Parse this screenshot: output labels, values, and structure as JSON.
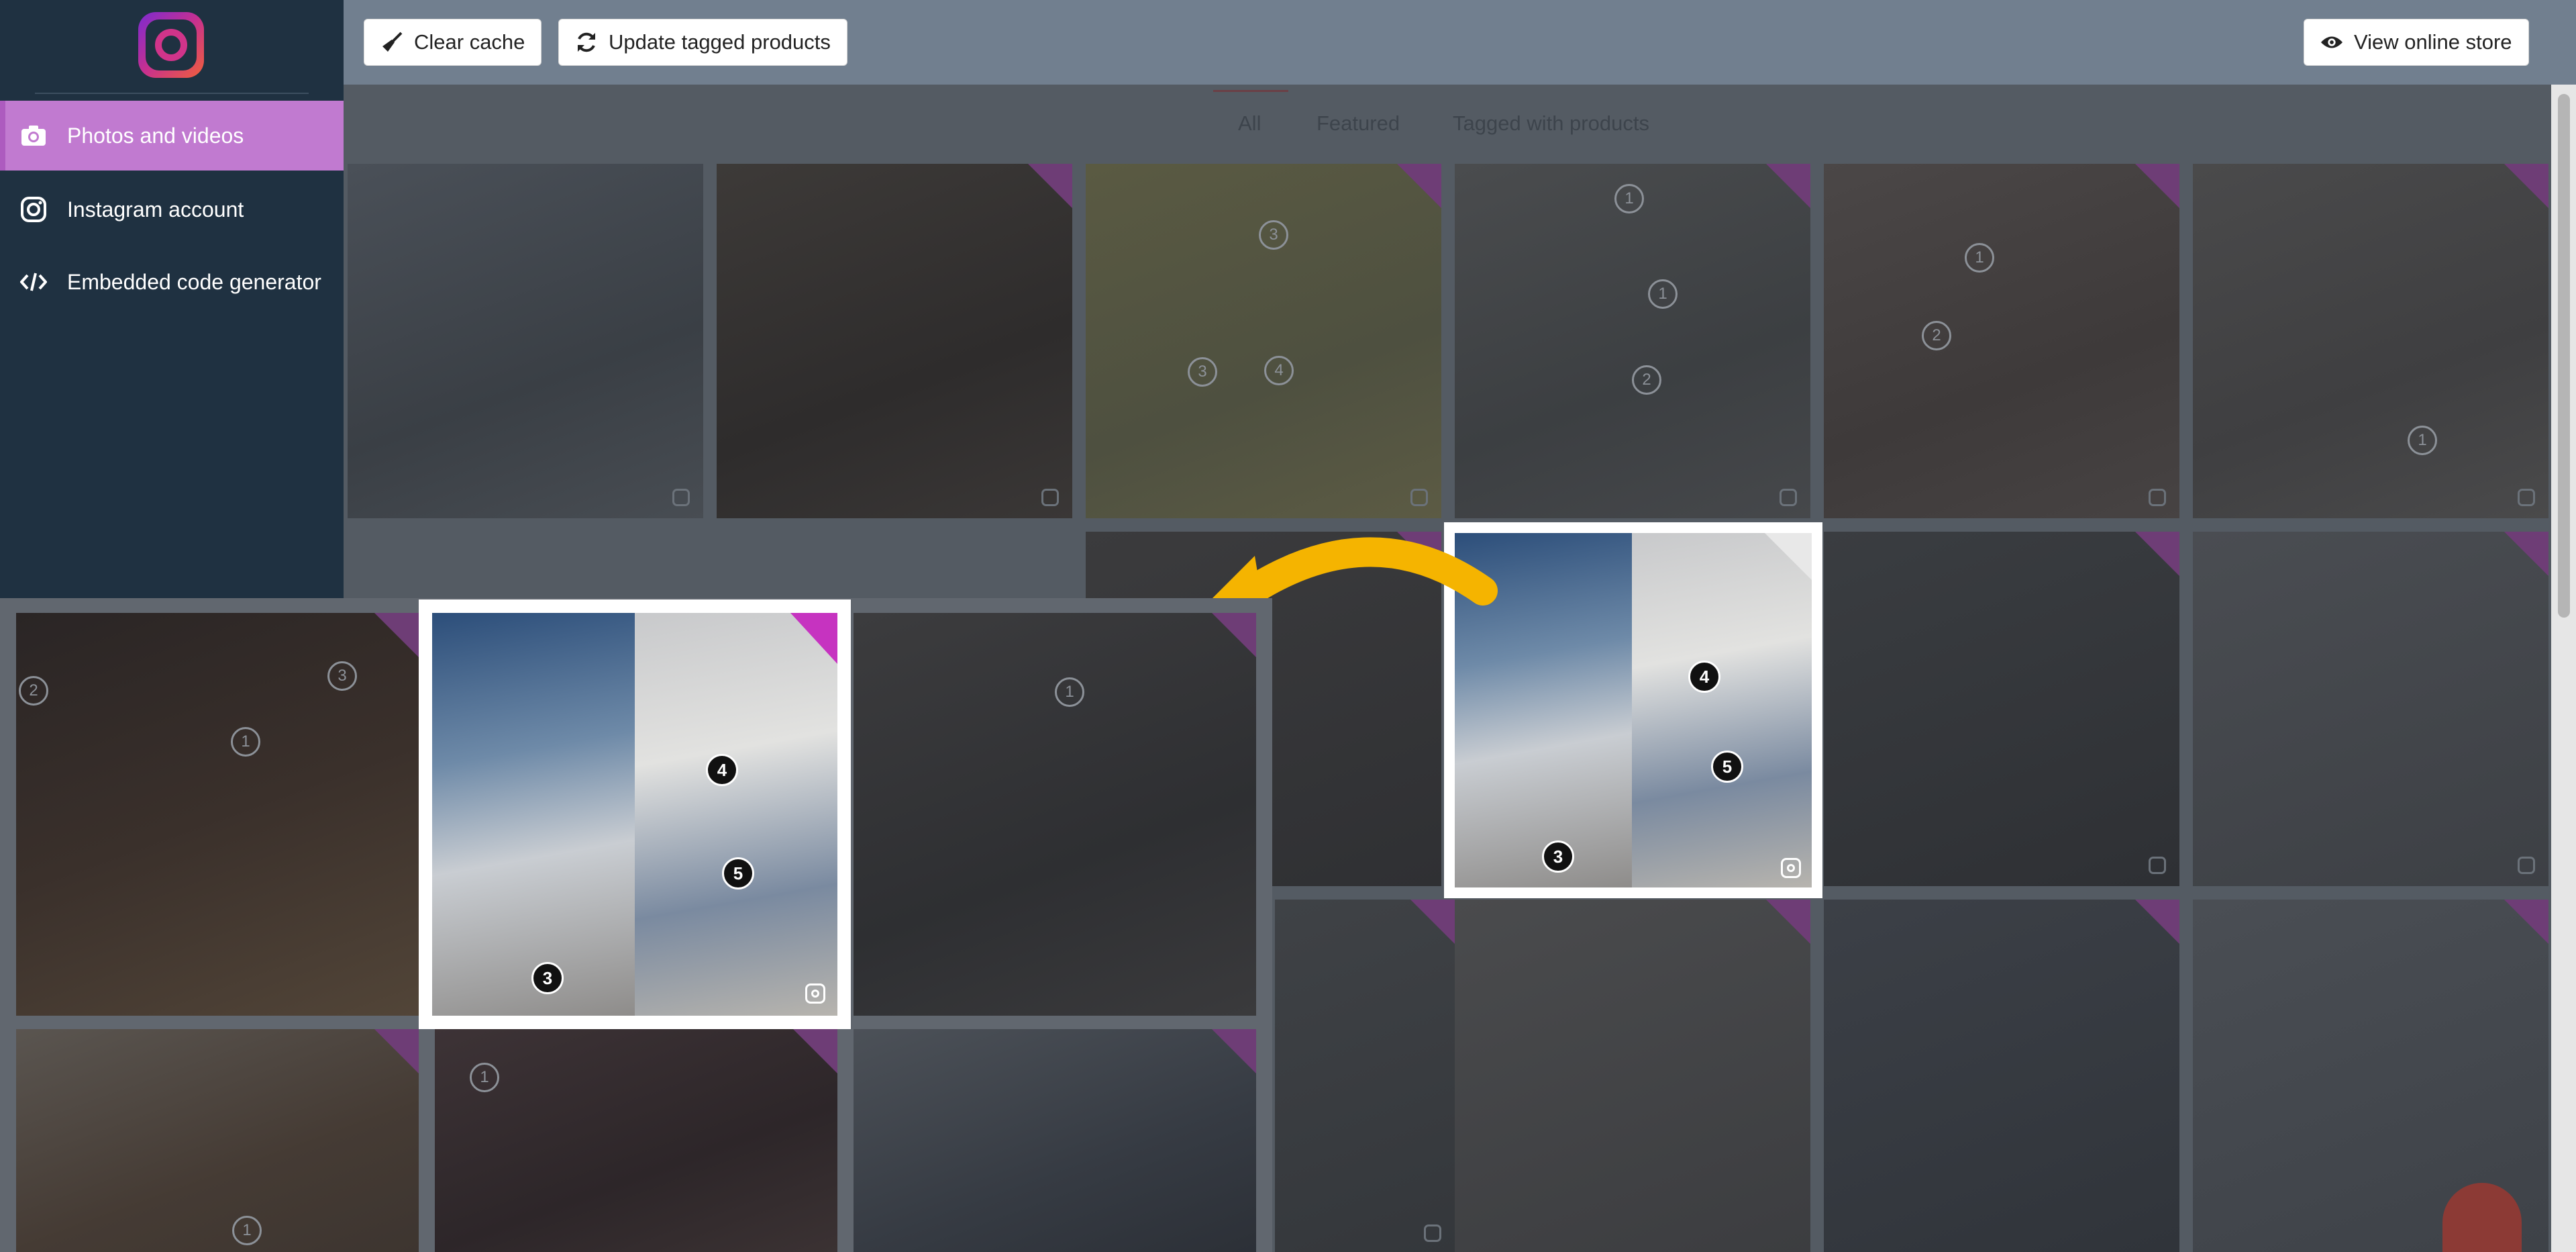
{
  "sidebar": {
    "items": [
      {
        "label": "Photos and videos",
        "icon": "camera-icon",
        "active": true
      },
      {
        "label": "Instagram account",
        "icon": "instagram-icon",
        "active": false
      },
      {
        "label": "Embedded code generator",
        "icon": "code-icon",
        "active": false
      }
    ]
  },
  "toolbar": {
    "clear_cache_label": "Clear cache",
    "update_tagged_label": "Update tagged products",
    "view_store_label": "View online store"
  },
  "tabs": [
    {
      "label": "All",
      "active": true
    },
    {
      "label": "Featured",
      "active": false
    },
    {
      "label": "Tagged with products",
      "active": false
    }
  ],
  "highlight_tile": {
    "pins": [
      "3",
      "4",
      "5"
    ]
  },
  "zoom_tiles": {
    "tile1_pins": [
      "2",
      "3",
      "1"
    ],
    "tile3_pins": [
      "1"
    ],
    "tile5_pins": [
      "1"
    ],
    "tile4_pins": [
      "1"
    ]
  },
  "grid_pins": {
    "t3": [
      "3",
      "3",
      "4"
    ],
    "t4": [
      "1",
      "1",
      "2"
    ],
    "t5": [
      "1",
      "2"
    ],
    "t6": [
      "1"
    ]
  },
  "colors": {
    "sidebar_bg": "#1f3141",
    "active_nav": "#c17ad0",
    "topbar_bg": "#717f8f",
    "arrow": "#f5b400",
    "check_badge": "#c633c0"
  }
}
